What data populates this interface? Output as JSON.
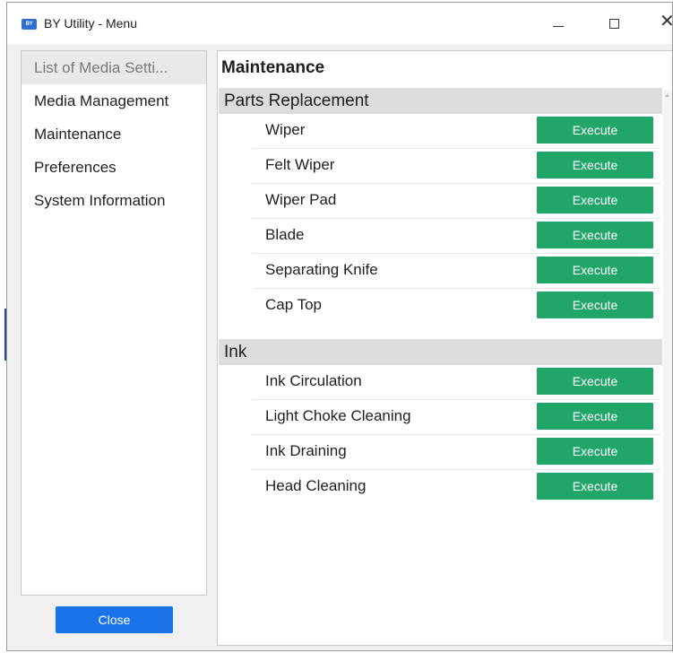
{
  "window": {
    "title": "BY Utility - Menu",
    "icon_text": "BY"
  },
  "titlebar_buttons": {
    "minimize_icon": "minimize-icon",
    "maximize_icon": "maximize-icon",
    "close_icon": "close-icon",
    "close_glyph": "✕"
  },
  "sidebar": {
    "items": [
      {
        "label": "List of Media Setti...",
        "selected": true
      },
      {
        "label": "Media Management",
        "selected": false
      },
      {
        "label": "Maintenance",
        "selected": false
      },
      {
        "label": "Preferences",
        "selected": false
      },
      {
        "label": "System Information",
        "selected": false
      }
    ]
  },
  "footer": {
    "close_label": "Close"
  },
  "main": {
    "title": "Maintenance",
    "sections": [
      {
        "title": "Parts Replacement",
        "rows": [
          {
            "label": "Wiper",
            "button": "Execute"
          },
          {
            "label": "Felt Wiper",
            "button": "Execute"
          },
          {
            "label": "Wiper Pad",
            "button": "Execute"
          },
          {
            "label": "Blade",
            "button": "Execute"
          },
          {
            "label": "Separating Knife",
            "button": "Execute"
          },
          {
            "label": "Cap Top",
            "button": "Execute"
          }
        ]
      },
      {
        "title": "Ink",
        "rows": [
          {
            "label": "Ink Circulation",
            "button": "Execute"
          },
          {
            "label": "Light Choke Cleaning",
            "button": "Execute"
          },
          {
            "label": "Ink Draining",
            "button": "Execute"
          },
          {
            "label": "Head Cleaning",
            "button": "Execute"
          }
        ]
      }
    ]
  },
  "colors": {
    "execute_button": "#21a568",
    "close_button": "#1a73e8",
    "section_header": "#dcdcdc",
    "selected_item": "#e9e9e9"
  }
}
